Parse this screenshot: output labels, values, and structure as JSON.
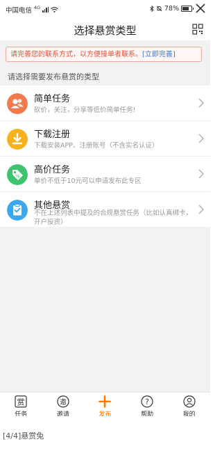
{
  "status_bar": {
    "carrier": "中国电信",
    "network": "4G",
    "battery": "78%"
  },
  "header": {
    "title": "选择悬赏类型"
  },
  "notice": {
    "text": "请完善您的联系方式，以方便接单者联系。",
    "link_label": "[立即完善]"
  },
  "section": {
    "title": "请选择需要发布悬赏的类型"
  },
  "task_types": [
    {
      "name": "简单任务",
      "description": "砍价，关注，分享等低价简单任务!",
      "icon": "user-group-icon",
      "color": "#f07a4e"
    },
    {
      "name": "下载注册",
      "description": "下载安装APP、注册账号（不含实名认证）",
      "icon": "download-icon",
      "color": "#f5b21c"
    },
    {
      "name": "高价任务",
      "description": "单价不低于10元可以申请发布此专区",
      "icon": "price-tag-icon",
      "color": "#3ec36e"
    },
    {
      "name": "其他悬赏",
      "description": "不在上述列表中提及的合规悬赏任务（比如认真绑卡，开户投资）",
      "icon": "checklist-icon",
      "color": "#3aa7f0"
    }
  ],
  "tabbar": {
    "tabs": [
      {
        "label": "任务",
        "icon": "task-icon"
      },
      {
        "label": "邀请",
        "icon": "invite-icon"
      },
      {
        "label": "发布",
        "icon": "plus-icon",
        "active": true
      },
      {
        "label": "帮助",
        "icon": "help-icon"
      },
      {
        "label": "我的",
        "icon": "profile-icon"
      }
    ]
  },
  "caption": "[4/4]悬赏兔",
  "colors": {
    "accent": "#ff7a00",
    "notice_text": "#e1533b",
    "link": "#3b7bd8"
  }
}
